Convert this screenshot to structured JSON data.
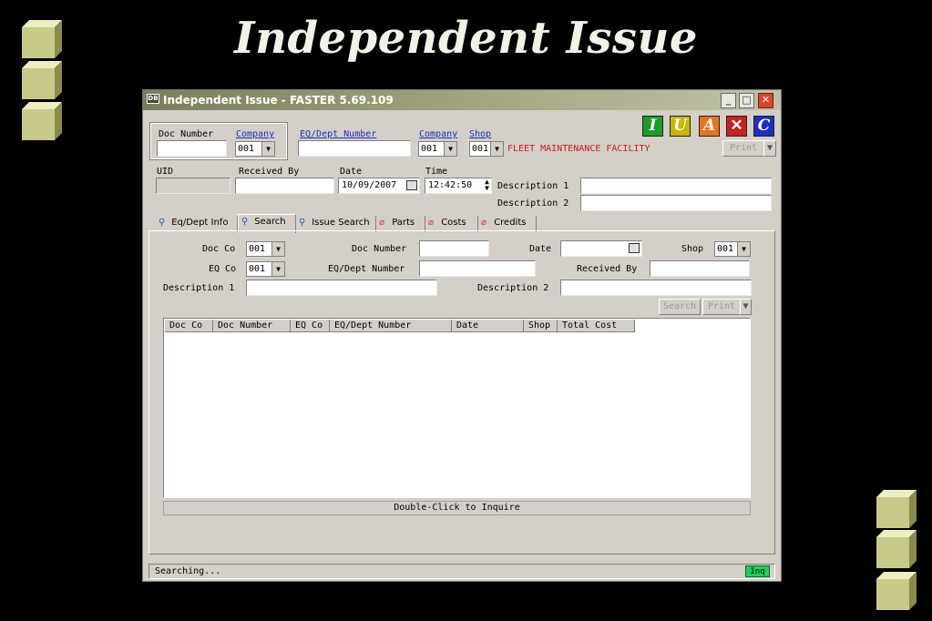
{
  "slide": {
    "title": "Independent Issue"
  },
  "window": {
    "title": "Independent Issue - FASTER 5.69.109",
    "app_icon": "DB"
  },
  "header": {
    "doc_number_label": "Doc Number",
    "company_label": "Company",
    "company_value": "001",
    "eq_dept_label": "EQ/Dept Number",
    "company2_label": "Company",
    "company2_value": "001",
    "shop_label": "Shop",
    "shop_value": "001",
    "shop_name": "FLEET MAINTENANCE FACILITY",
    "print_label": "Print",
    "uid_label": "UID",
    "received_by_label": "Received By",
    "date_label": "Date",
    "date_value": "10/09/2007",
    "time_label": "Time",
    "time_value": "12:42:50",
    "description1_label": "Description 1",
    "description2_label": "Description 2"
  },
  "toolbar": {
    "buttons": [
      {
        "label": "I",
        "color": "#1c9c2c"
      },
      {
        "label": "U",
        "color": "#c9b800"
      },
      {
        "label": "A",
        "color": "#e9741c"
      },
      {
        "label": "✕",
        "color": "#c8201c"
      },
      {
        "label": "C",
        "color": "#1c2ec4"
      }
    ]
  },
  "tabs": [
    {
      "label": "Eq/Dept Info",
      "icon": "magnifier-icon"
    },
    {
      "label": "Search",
      "icon": "magnifier-icon"
    },
    {
      "label": "Issue Search",
      "icon": "magnifier-icon"
    },
    {
      "label": "Parts",
      "icon": "paperclip-icon"
    },
    {
      "label": "Costs",
      "icon": "paperclip-icon"
    },
    {
      "label": "Credits",
      "icon": "paperclip-icon"
    }
  ],
  "search": {
    "doc_co_label": "Doc Co",
    "doc_co_value": "001",
    "doc_number_label": "Doc Number",
    "date_label": "Date",
    "shop_label": "Shop",
    "shop_value": "001",
    "eq_co_label": "EQ Co",
    "eq_co_value": "001",
    "eq_dept_label": "EQ/Dept Number",
    "received_by_label": "Received By",
    "description1_label": "Description 1",
    "description2_label": "Description 2",
    "search_button": "Search",
    "print_button": "Print"
  },
  "grid": {
    "columns": [
      "Doc Co",
      "Doc Number",
      "EQ Co",
      "EQ/Dept Number",
      "Date",
      "Shop",
      "Total Cost"
    ],
    "footer": "Double-Click to Inquire"
  },
  "status": {
    "text": "Searching...",
    "badge": "Inq"
  }
}
